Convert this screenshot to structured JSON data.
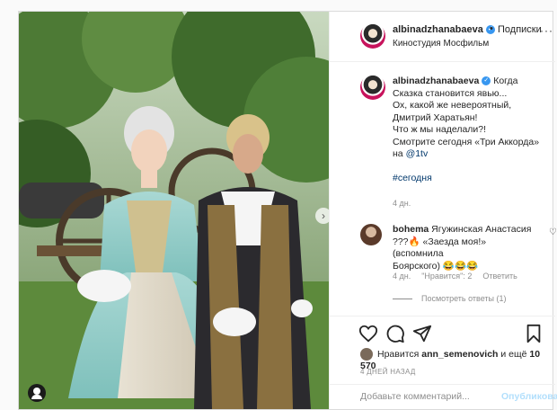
{
  "colors": {
    "accent": "#3897f0",
    "link": "#00376b",
    "muted": "#8e8e8e",
    "border": "#dbdbdb",
    "publish_disabled": "#b2dffc"
  },
  "header": {
    "username": "albinadzhanabaeva",
    "verified_icon": "verified-badge-icon",
    "separator": "•",
    "follow_label": "Подписки",
    "location": "Киностудия Мосфильм",
    "more_icon": "more-horizontal-icon",
    "more_glyph": "···"
  },
  "caption": {
    "username": "albinadzhanabaeva",
    "line1": " Когда Сказка становится явью...",
    "line2": "Ох, какой же невероятный, Дмитрий Харатьян!",
    "line3": "Что ж мы наделали?!",
    "line4_prefix": "Смотрите сегодня «Три Аккорда» на ",
    "line4_link": "@1tv",
    "hashtag": "#сегодня",
    "time": "4 дн."
  },
  "comment": {
    "username": "bohema",
    "text_line1": " Ягужинская Анастасия",
    "text_line2": "???🔥 «Заезда моя!» (вспомнила",
    "text_line3": "Боярского) 😂😂😂",
    "time": "4 дн.",
    "likes_text": "\"Нравится\": 2",
    "reply_label": "Ответить",
    "view_replies": "Посмотреть ответы (1)"
  },
  "actions": {
    "like_icon": "heart-icon",
    "comment_icon": "comment-icon",
    "share_icon": "share-icon",
    "save_icon": "bookmark-icon"
  },
  "likes": {
    "prefix": "Нравится ",
    "user": "ann_semenovich",
    "middle": " и ещё ",
    "count": "10 570"
  },
  "post_time": "4 ДНЕЙ НАЗАД",
  "add_comment": {
    "placeholder": "Добавьте комментарий...",
    "publish_label": "Опубликовать"
  },
  "photo": {
    "next_icon": "chevron-right-icon",
    "next_glyph": "›",
    "tag_icon": "user-tag-icon"
  }
}
